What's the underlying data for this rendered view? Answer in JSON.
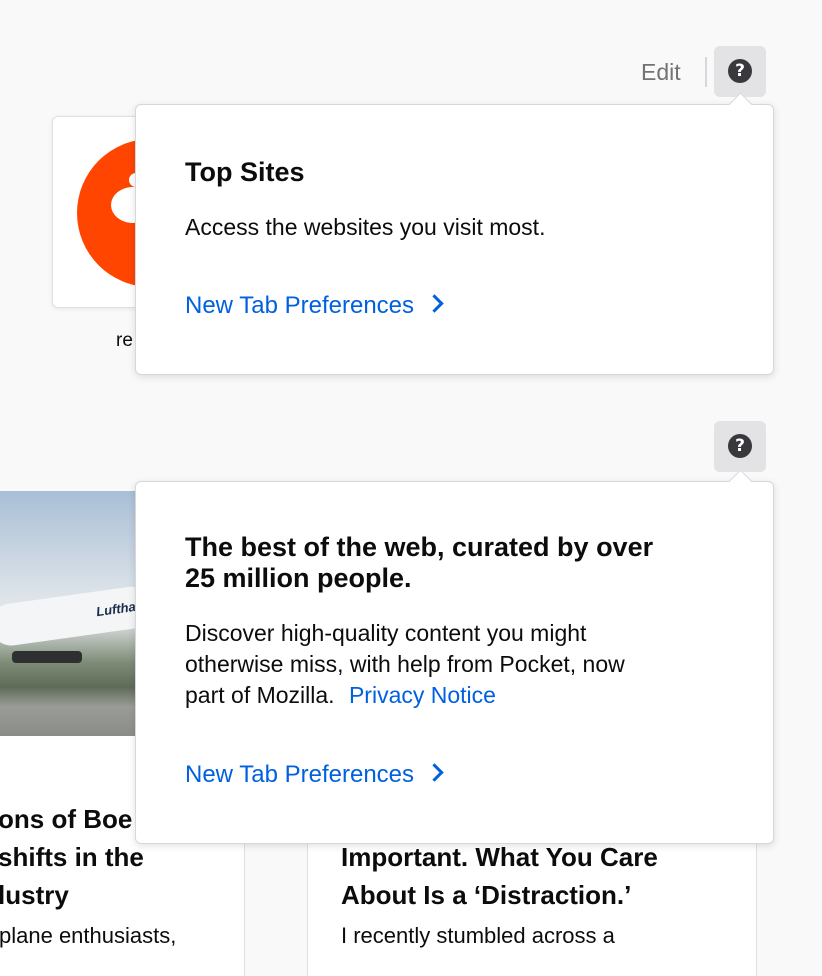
{
  "header": {
    "edit_label": "Edit"
  },
  "top_sites": {
    "tile_label": "re",
    "popover": {
      "title": "Top Sites",
      "body": "Access the websites you visit most.",
      "link": "New Tab Preferences"
    }
  },
  "pocket": {
    "popover": {
      "title_line1": "The best of the web, curated by over",
      "title_line2": "25 million people.",
      "body_line1": "Discover high-quality content you might",
      "body_line2": "otherwise miss, with help from Pocket, now",
      "body_line3": "part of Mozilla.",
      "privacy_link": "Privacy Notice",
      "link": "New Tab Preferences"
    },
    "stories": [
      {
        "image_text": "Lufthan",
        "title_lines": [
          "ons of Boe",
          "shifts in the",
          "lustry"
        ],
        "excerpt": "plane enthusiasts,"
      },
      {
        "title_lines": [
          "Important. What You Care",
          "About Is a ‘Distraction.’"
        ],
        "excerpt": "I recently stumbled across a"
      }
    ]
  },
  "colors": {
    "link": "#0060df",
    "reddit": "#ff4500",
    "help_button_bg": "#e3e3e6"
  }
}
